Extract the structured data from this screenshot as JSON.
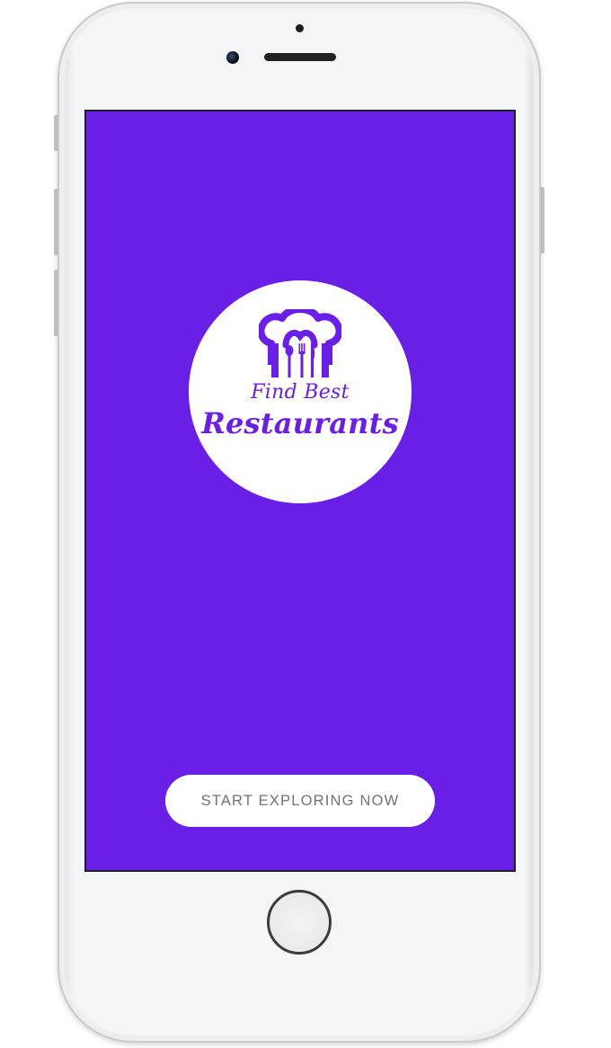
{
  "logo": {
    "line1": "Find Best",
    "line2": "Restaurants",
    "icon": "chef-hat-cutlery-icon"
  },
  "cta": {
    "label": "START EXPLORING NOW"
  },
  "colors": {
    "accent": "#6a1fe6",
    "button_text": "#7a6e78",
    "logo_bg": "#ffffff"
  }
}
